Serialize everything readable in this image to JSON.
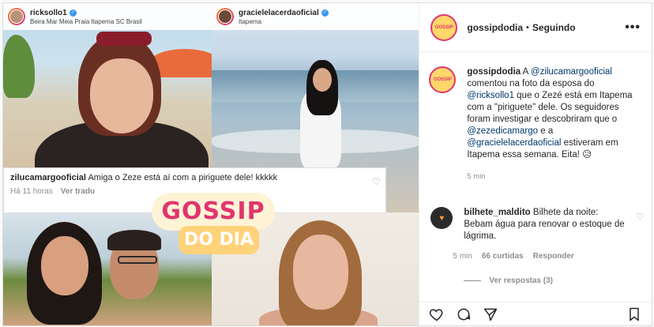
{
  "collage": {
    "panel1": {
      "username": "ricksollo1",
      "location": "Beira Mar Meia Praia Itapema SC Brasil"
    },
    "panel2": {
      "username": "gracielelacerdaoficial",
      "location": "Itapema"
    },
    "comment_overlay": {
      "username": "zilucamargooficial",
      "text": "Amiga o Zeze está aí com a piriguete dele! kkkkk",
      "time": "Há 11 horas",
      "translate": "Ver tradu"
    },
    "logo": {
      "top": "GOSSIP",
      "bottom": "DO DIA"
    }
  },
  "header": {
    "account": "gossipdodia",
    "separator": "•",
    "follow_status": "Seguindo",
    "more": "•••"
  },
  "post": {
    "author": "gossipdodia",
    "t1": "A ",
    "m1": "@zilucamargooficial",
    "t2": " comentou na foto da esposa do ",
    "m2": "@ricksollo1",
    "t3": " que o Zezé está em Itapema com a \"piriguete\" dele. Os seguidores foram investigar e descobriram que o ",
    "m3": "@zezedicamargo",
    "t4": " e a ",
    "m4": "@gracielelacerdaoficial",
    "t5": " estiveram em Itapema essa semana. Eita! 😥",
    "time": "5 min"
  },
  "comment": {
    "username": "bilhete_maldito",
    "text": "Bilhete da noite: Bebam água para renovar o estoque de lágrima.",
    "time": "5 min",
    "likes": "66 curtidas",
    "reply": "Responder",
    "view_replies": "Ver respostas (3)"
  },
  "colors": {
    "accent": "#e0356f",
    "mention": "#00376b",
    "secondary_text": "#8e8e8e"
  }
}
